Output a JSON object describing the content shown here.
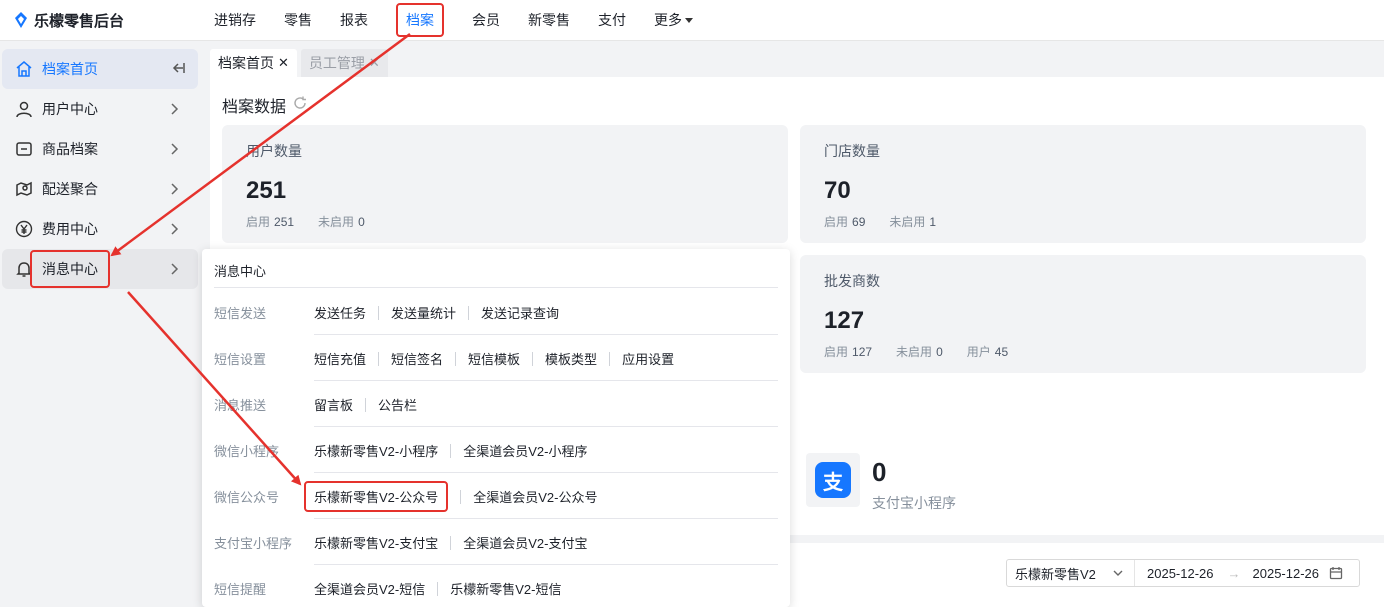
{
  "brand": {
    "name": "乐檬零售后台"
  },
  "nav": {
    "items": [
      {
        "label": "进销存"
      },
      {
        "label": "零售"
      },
      {
        "label": "报表"
      },
      {
        "label": "档案"
      },
      {
        "label": "会员"
      },
      {
        "label": "新零售"
      },
      {
        "label": "支付"
      },
      {
        "label": "更多"
      }
    ]
  },
  "sidebar": {
    "items": [
      {
        "label": "档案首页"
      },
      {
        "label": "用户中心"
      },
      {
        "label": "商品档案"
      },
      {
        "label": "配送聚合"
      },
      {
        "label": "费用中心"
      },
      {
        "label": "消息中心"
      }
    ]
  },
  "tabs": [
    {
      "label": "档案首页",
      "close": "✕"
    },
    {
      "label": "员工管理",
      "close": "✕"
    }
  ],
  "section": {
    "title": "档案数据"
  },
  "cards": [
    {
      "label": "用户数量",
      "value": "251",
      "subs": [
        {
          "k": "启用",
          "v": "251"
        },
        {
          "k": "未启用",
          "v": "0"
        }
      ]
    },
    {
      "label": "门店数量",
      "value": "70",
      "subs": [
        {
          "k": "启用",
          "v": "69"
        },
        {
          "k": "未启用",
          "v": "1"
        }
      ]
    },
    {
      "label": "批发商数",
      "value": "127",
      "subs": [
        {
          "k": "启用",
          "v": "127"
        },
        {
          "k": "未启用",
          "v": "0"
        },
        {
          "k": "用户",
          "v": "45"
        }
      ]
    }
  ],
  "alipay": {
    "icon_text": "支",
    "count": "0",
    "label": "支付宝小程序"
  },
  "filter": {
    "select": "乐檬新零售V2",
    "date_start": "2025-12-26",
    "arrow": "→",
    "date_end": "2025-12-26"
  },
  "menu": {
    "title": "消息中心",
    "rows": [
      {
        "label": "短信发送",
        "links": [
          "发送任务",
          "发送量统计",
          "发送记录查询"
        ]
      },
      {
        "label": "短信设置",
        "links": [
          "短信充值",
          "短信签名",
          "短信模板",
          "模板类型",
          "应用设置"
        ]
      },
      {
        "label": "消息推送",
        "links": [
          "留言板",
          "公告栏"
        ]
      },
      {
        "label": "微信小程序",
        "links": [
          "乐檬新零售V2-小程序",
          "全渠道会员V2-小程序"
        ]
      },
      {
        "label": "微信公众号",
        "links": [
          "乐檬新零售V2-公众号",
          "全渠道会员V2-公众号"
        ]
      },
      {
        "label": "支付宝小程序",
        "links": [
          "乐檬新零售V2-支付宝",
          "全渠道会员V2-支付宝"
        ]
      },
      {
        "label": "短信提醒",
        "links": [
          "全渠道会员V2-短信",
          "乐檬新零售V2-短信"
        ]
      }
    ]
  },
  "colors": {
    "accent": "#1677ff",
    "annotation": "#e5322d"
  }
}
